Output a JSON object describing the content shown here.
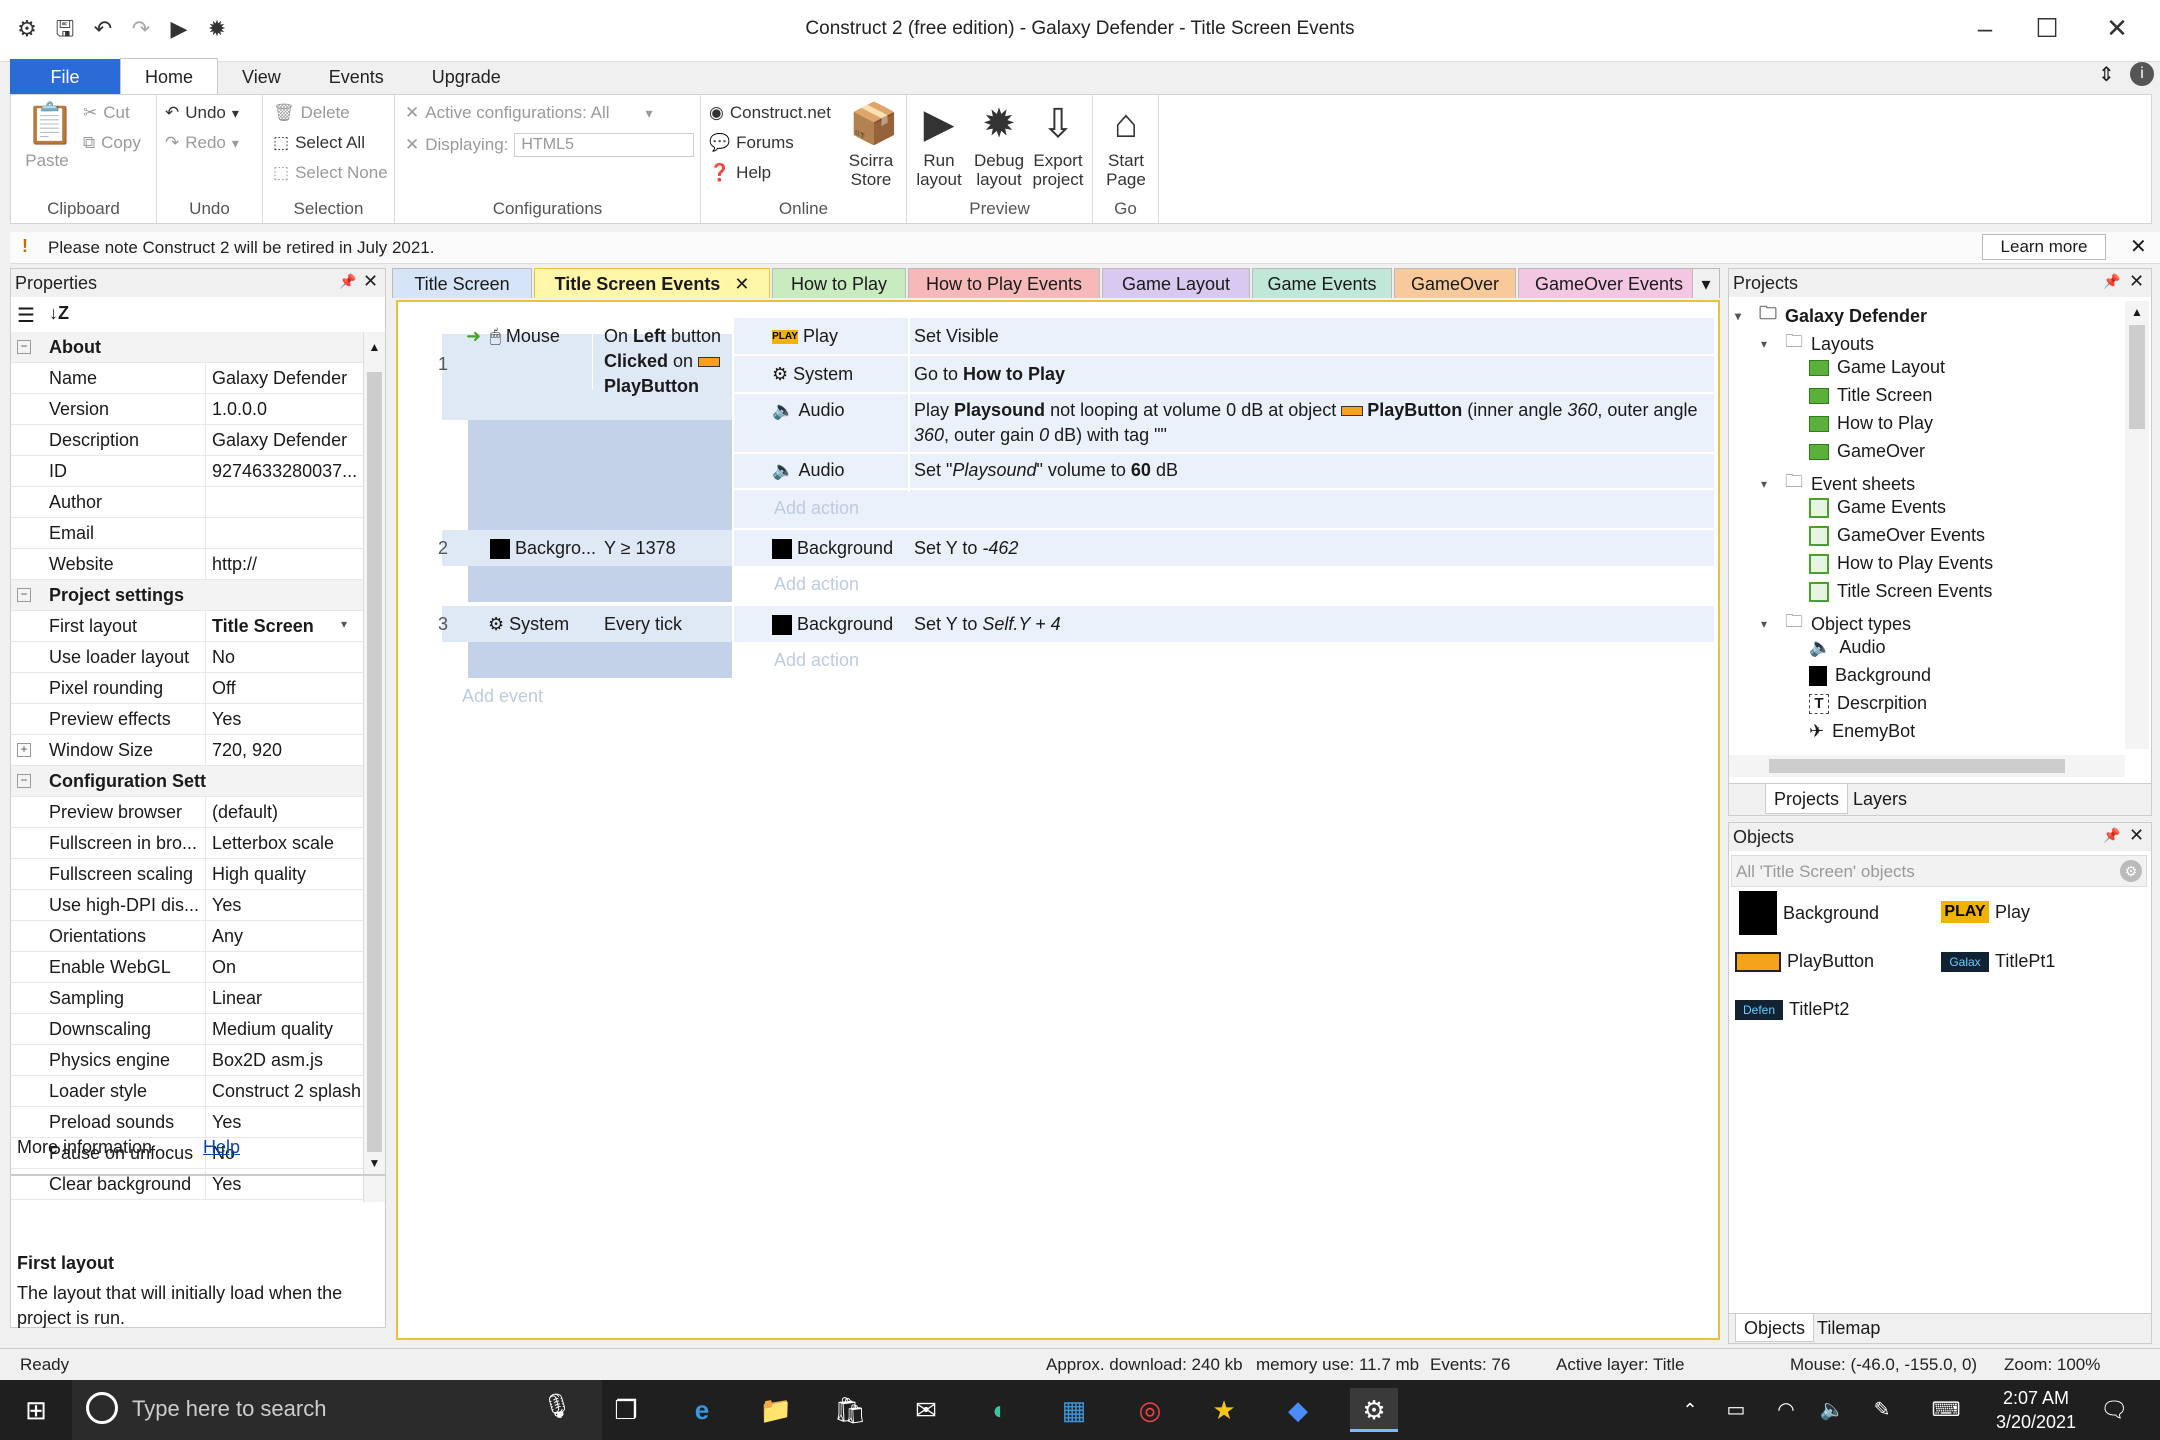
{
  "window": {
    "title": "Construct 2  (free edition) - Galaxy Defender - Title Screen Events"
  },
  "ribbon_tabs": [
    "File",
    "Home",
    "View",
    "Events",
    "Upgrade"
  ],
  "ribbon": {
    "clipboard": {
      "label": "Clipboard",
      "paste": "Paste",
      "cut": "Cut",
      "copy": "Copy"
    },
    "undo": {
      "label": "Undo",
      "undo": "Undo",
      "redo": "Redo"
    },
    "selection": {
      "label": "Selection",
      "delete": "Delete",
      "select_all": "Select All",
      "select_none": "Select None"
    },
    "configurations": {
      "label": "Configurations",
      "active_label": "Active configurations: All",
      "displaying_label": "Displaying:",
      "displaying_value": "HTML5"
    },
    "online": {
      "label": "Online",
      "construct_net": "Construct.net",
      "forums": "Forums",
      "help": "Help",
      "scirra_store_1": "Scirra",
      "scirra_store_2": "Store"
    },
    "preview": {
      "label": "Preview",
      "run_1": "Run",
      "run_2": "layout",
      "debug_1": "Debug",
      "debug_2": "layout",
      "export_1": "Export",
      "export_2": "project"
    },
    "go": {
      "label": "Go",
      "start_1": "Start",
      "start_2": "Page"
    }
  },
  "notice": {
    "text": "Please note Construct 2 will be retired in July 2021.",
    "learn_more": "Learn more"
  },
  "properties": {
    "title": "Properties",
    "rows": [
      {
        "type": "cat",
        "k": "About"
      },
      {
        "k": "Name",
        "v": "Galaxy Defender"
      },
      {
        "k": "Version",
        "v": "1.0.0.0"
      },
      {
        "k": "Description",
        "v": "Galaxy Defender"
      },
      {
        "k": "ID",
        "v": "9274633280037..."
      },
      {
        "k": "Author",
        "v": ""
      },
      {
        "k": "Email",
        "v": ""
      },
      {
        "k": "Website",
        "v": "http://"
      },
      {
        "type": "cat",
        "k": "Project settings"
      },
      {
        "k": "First layout",
        "v": "Title Screen",
        "bold": true
      },
      {
        "k": "Use loader layout",
        "v": "No"
      },
      {
        "k": "Pixel rounding",
        "v": "Off"
      },
      {
        "k": "Preview effects",
        "v": "Yes"
      },
      {
        "k": "Window Size",
        "v": "720, 920",
        "plus": true
      },
      {
        "type": "cat",
        "k": "Configuration Settings"
      },
      {
        "k": "Preview browser",
        "v": "(default)"
      },
      {
        "k": "Fullscreen in bro...",
        "v": "Letterbox scale"
      },
      {
        "k": "Fullscreen scaling",
        "v": "High quality"
      },
      {
        "k": "Use high-DPI dis...",
        "v": "Yes"
      },
      {
        "k": "Orientations",
        "v": "Any"
      },
      {
        "k": "Enable WebGL",
        "v": "On"
      },
      {
        "k": "Sampling",
        "v": "Linear"
      },
      {
        "k": "Downscaling",
        "v": "Medium quality"
      },
      {
        "k": "Physics engine",
        "v": "Box2D asm.js"
      },
      {
        "k": "Loader style",
        "v": "Construct 2 splash"
      },
      {
        "k": "Preload sounds",
        "v": "Yes"
      },
      {
        "k": "Pause on unfocus",
        "v": "No"
      },
      {
        "k": "Clear background",
        "v": "Yes"
      }
    ],
    "more_info": "More information",
    "help_link": "Help",
    "desc_title": "First layout",
    "desc_text": "The layout that will initially load when the project is run."
  },
  "event_tabs": [
    {
      "label": "Title Screen",
      "color": "#d6e4f7"
    },
    {
      "label": "Title Screen Events",
      "color": "#fff6a8",
      "active": true
    },
    {
      "label": "How to Play",
      "color": "#c9ebc0"
    },
    {
      "label": "How to Play Events",
      "color": "#f6b8b8"
    },
    {
      "label": "Game Layout",
      "color": "#d9c8f0"
    },
    {
      "label": "Game Events",
      "color": "#bfe8d8"
    },
    {
      "label": "GameOver",
      "color": "#f8c99a"
    },
    {
      "label": "GameOver Events",
      "color": "#f3c6e2"
    }
  ],
  "events": [
    {
      "num": "1",
      "cond_obj": "Mouse",
      "cond_l1a": "On ",
      "cond_l1b": "Left",
      "cond_l1c": " button",
      "cond_l2a": "Clicked",
      "cond_l2b": " on",
      "cond_l3": "PlayButton",
      "actions": [
        {
          "obj": "Play",
          "text": "Set Visible"
        },
        {
          "obj": "System",
          "pre": "Go to ",
          "bold": "How to Play"
        },
        {
          "obj": "Audio",
          "pre": "Play ",
          "bold": "Playsound",
          "post": " not looping at volume 0 dB at object ",
          "bold2": "PlayButton",
          "post2": " (inner angle ",
          "it1": "360",
          "post3": ", outer angle",
          "line2a": "360",
          "line2b": ", outer gain ",
          "line2c": "0",
          "line2d": " dB) with tag \"\""
        },
        {
          "obj": "Audio",
          "pre": "Set \"",
          "it": "Playsound",
          "mid": "\" volume to ",
          "bold": "60",
          "post": " dB"
        }
      ]
    },
    {
      "num": "2",
      "cond_obj": "Backgro...",
      "cond": "Y ≥ 1378",
      "actions": [
        {
          "obj": "Background",
          "pre": "Set Y to ",
          "it": "-462"
        }
      ]
    },
    {
      "num": "3",
      "cond_obj": "System",
      "cond": "Every tick",
      "actions": [
        {
          "obj": "Background",
          "pre": "Set Y to ",
          "it": "Self.Y + 4"
        }
      ]
    }
  ],
  "add_action": "Add action",
  "add_event": "Add event",
  "projects": {
    "title": "Projects",
    "root": "Galaxy Defender",
    "layouts": "Layouts",
    "layout_items": [
      "Game Layout",
      "Title Screen",
      "How to Play",
      "GameOver"
    ],
    "event_sheets": "Event sheets",
    "sheet_items": [
      "Game Events",
      "GameOver Events",
      "How to Play Events",
      "Title Screen Events"
    ],
    "object_types": "Object types",
    "object_items": [
      "Audio",
      "Background",
      "Descrpition",
      "EnemyBot"
    ],
    "tabs": [
      "Projects",
      "Layers"
    ]
  },
  "objects": {
    "title": "Objects",
    "filter": "All 'Title Screen' objects",
    "items": [
      "Background",
      "Play",
      "PlayButton",
      "TitlePt1",
      "TitlePt2"
    ],
    "tabs": [
      "Objects",
      "Tilemap"
    ]
  },
  "status": {
    "ready": "Ready",
    "download": "Approx. download: 240 kb",
    "memory": "memory use: 11.7 mb",
    "events": "Events: 76",
    "layer": "Active layer: Title",
    "mouse": "Mouse: (-46.0, -155.0, 0)",
    "zoom": "Zoom: 100%"
  },
  "taskbar": {
    "search": "Type here to search",
    "time": "2:07 AM",
    "date": "3/20/2021"
  }
}
